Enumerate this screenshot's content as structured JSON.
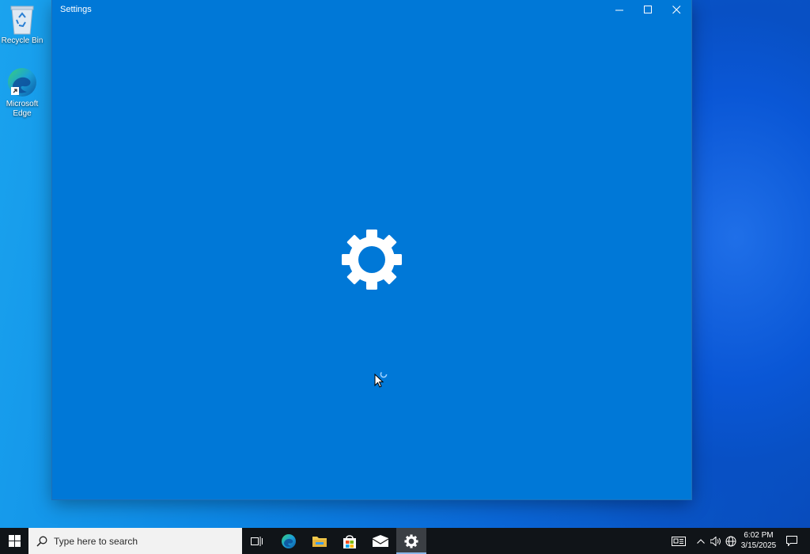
{
  "desktop": {
    "icons": [
      {
        "label": "Recycle Bin",
        "icon": "recycle-bin-icon"
      },
      {
        "label": "Microsoft Edge",
        "icon": "edge-icon"
      }
    ]
  },
  "window": {
    "title": "Settings",
    "controls": [
      "minimize-icon",
      "maximize-icon",
      "close-icon"
    ],
    "splash_icon": "gear-icon",
    "background_color": "#0078d7"
  },
  "taskbar": {
    "search_placeholder": "Type here to search",
    "pinned": [
      "start-icon",
      "task-view-icon",
      "edge-icon",
      "file-explorer-icon",
      "store-icon",
      "mail-icon",
      "settings-icon"
    ],
    "active": "settings-icon",
    "tray": [
      "news-icon",
      "chevron-up-icon",
      "volume-icon",
      "network-icon",
      "notifications-icon"
    ],
    "clock": {
      "time": "6:02 PM",
      "date": "3/15/2025"
    }
  }
}
